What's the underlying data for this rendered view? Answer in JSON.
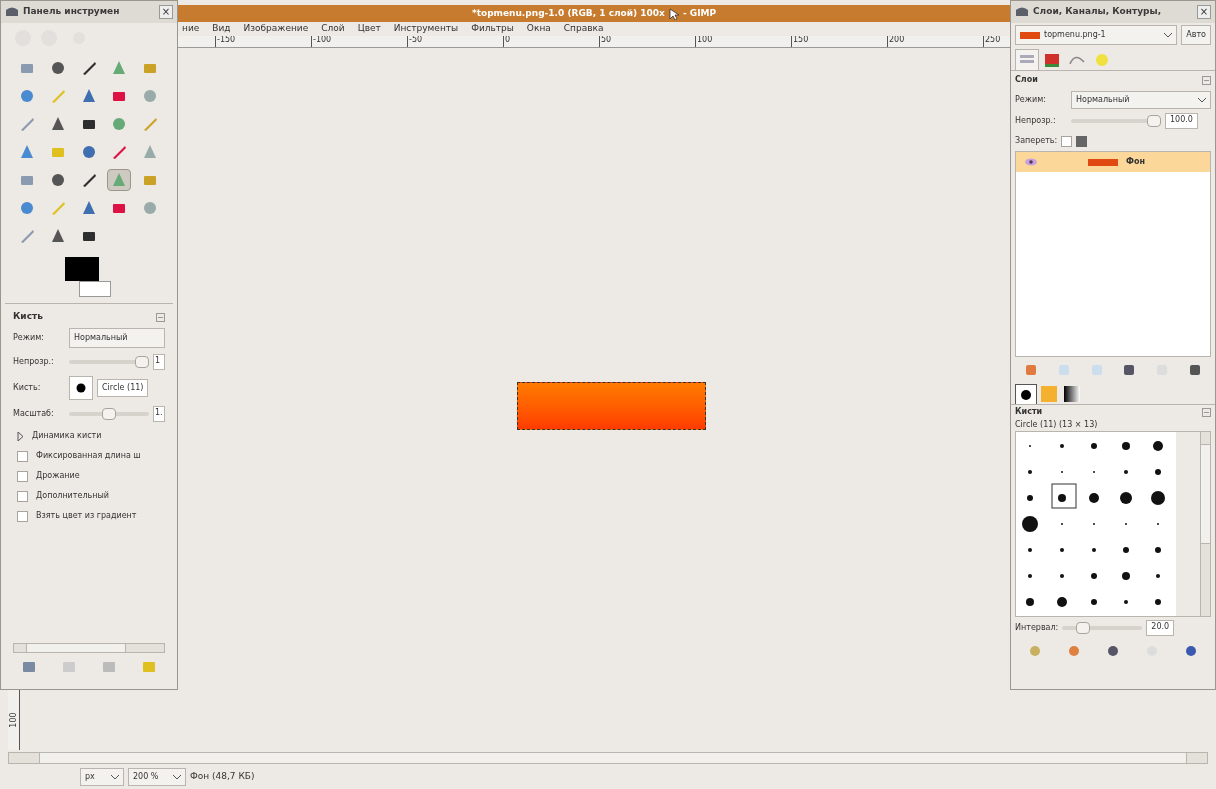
{
  "toolbox": {
    "title": "Панель инструмен",
    "close": "×",
    "tools": [
      {
        "selected": false
      },
      {
        "selected": false
      },
      {
        "selected": false
      },
      {
        "selected": false
      },
      {
        "selected": false
      },
      {
        "selected": false
      },
      {
        "selected": false
      },
      {
        "selected": false
      },
      {
        "selected": false
      },
      {
        "selected": false
      },
      {
        "selected": false
      },
      {
        "selected": false
      },
      {
        "selected": false
      },
      {
        "selected": false
      },
      {
        "selected": false
      },
      {
        "selected": false
      },
      {
        "selected": false
      },
      {
        "selected": false
      },
      {
        "selected": false
      },
      {
        "selected": false
      },
      {
        "selected": false
      },
      {
        "selected": false
      },
      {
        "selected": false
      },
      {
        "selected": true
      },
      {
        "selected": false
      },
      {
        "selected": false
      },
      {
        "selected": false
      },
      {
        "selected": false
      },
      {
        "selected": false
      },
      {
        "selected": false
      },
      {
        "selected": false
      },
      {
        "selected": false
      },
      {
        "selected": false
      }
    ],
    "options": {
      "title": "Кисть",
      "mode_label": "Режим:",
      "mode": "Нормальный",
      "opacity_label": "Непрозр.:",
      "opacity": {
        "level": 1.0,
        "value": "1"
      },
      "brush_label": "Кисть:",
      "brush": "Circle (11)",
      "scale_label": "Масштаб:",
      "scale": {
        "level": 0.5,
        "value": "1."
      },
      "dynamics": {
        "label": "Динамика кисти",
        "expanded": false
      },
      "checkboxes": [
        {
          "label": "Фиксированная длина ш",
          "checked": false
        },
        {
          "label": "Дрожание",
          "checked": false
        },
        {
          "label": "Дополнительный",
          "checked": false
        },
        {
          "label": "Взять цвет из градиент",
          "checked": false
        }
      ]
    }
  },
  "image_window": {
    "title": "*topmenu.png-1.0 (RGB, 1 слой) 100x",
    "title_suffix": "- GIMP",
    "menu": [
      "ние",
      "Вид",
      "Изображение",
      "Слой",
      "Цвет",
      "Инструменты",
      "Фильтры",
      "Окна",
      "Справка"
    ],
    "ruler": [
      "-150",
      "-100",
      "-50",
      "0",
      "50",
      "100",
      "150",
      "200",
      "250"
    ],
    "vertical_ruler": "100",
    "status": {
      "unit": "px",
      "zoom": "200 %",
      "info": "Фон (48,7 КБ)"
    }
  },
  "dock": {
    "title": "Слои, Каналы, Контуры, ",
    "close": "×",
    "image": "topmenu.png-1",
    "auto": "Авто",
    "tabs": [
      {
        "selected": true
      },
      {
        "selected": false
      },
      {
        "selected": false
      },
      {
        "selected": false
      }
    ],
    "layers": {
      "title": "Слои",
      "mode_label": "Режим:",
      "mode": "Нормальный",
      "opacity_label": "Непрозр.:",
      "opacity": {
        "level": 1.0,
        "value": "100.0"
      },
      "lock_label": "Запереть:",
      "lock_checked": false,
      "items": [
        {
          "name": "Фон",
          "visible": true,
          "selected": true
        }
      ]
    },
    "brush_tabs": [
      {
        "selected": true
      },
      {
        "selected": false
      },
      {
        "selected": false
      }
    ],
    "brushes": {
      "title": "Кисти",
      "current": "Circle (11) (13 × 13)",
      "spacing_label": "Интервал:",
      "spacing": {
        "level": 0.2,
        "value": "20.0"
      }
    }
  }
}
